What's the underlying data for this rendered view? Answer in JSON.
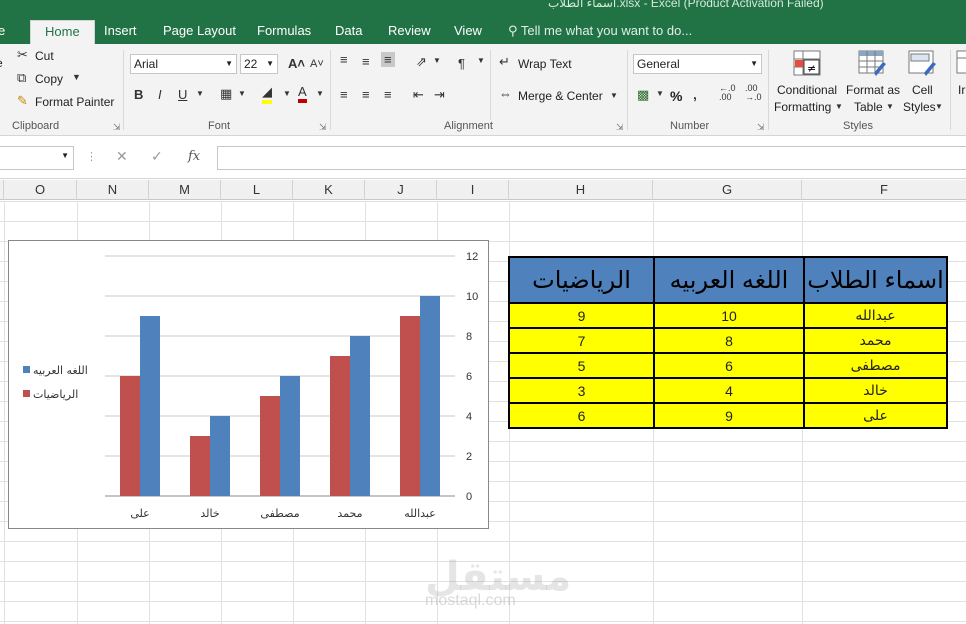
{
  "window": {
    "title": "اسماء الطلاب.xlsx - Excel (Product Activation Failed)"
  },
  "tabs": [
    "Home",
    "Insert",
    "Page Layout",
    "Formulas",
    "Data",
    "Review",
    "View"
  ],
  "tell_me": "Tell me what you want to do...",
  "ribbon": {
    "clipboard": {
      "label": "Clipboard",
      "cut": "Cut",
      "copy": "Copy",
      "format_painter": "Format Painter"
    },
    "font": {
      "label": "Font",
      "name": "Arial",
      "size": "22"
    },
    "alignment": {
      "label": "Alignment",
      "wrap_text": "Wrap Text",
      "merge_center": "Merge & Center"
    },
    "number": {
      "label": "Number",
      "format": "General",
      "percent": "%"
    },
    "styles": {
      "label": "Styles",
      "conditional_1": "Conditional",
      "conditional_2": "Formatting",
      "format_as_1": "Format as",
      "format_as_2": "Table",
      "cell_1": "Cell",
      "cell_2": "Styles",
      "insert_partial": "Ir"
    }
  },
  "formula_bar": {
    "fx": "fx",
    "value": ""
  },
  "columns": [
    "O",
    "N",
    "M",
    "L",
    "K",
    "J",
    "I",
    "H",
    "G",
    "F"
  ],
  "table": {
    "headers": [
      "الرياضيات",
      "اللغه العربيه",
      "اسماء الطلاب"
    ],
    "rows": [
      [
        "9",
        "10",
        "عبدالله"
      ],
      [
        "7",
        "8",
        "محمد"
      ],
      [
        "5",
        "6",
        "مصطفى"
      ],
      [
        "3",
        "4",
        "خالد"
      ],
      [
        "6",
        "9",
        "على"
      ]
    ]
  },
  "chart_data": {
    "type": "bar",
    "categories": [
      "على",
      "خالد",
      "مصطفى",
      "محمد",
      "عبدالله"
    ],
    "series": [
      {
        "name": "الرياضيات",
        "color": "#c0504d",
        "values": [
          6,
          3,
          5,
          7,
          9
        ]
      },
      {
        "name": "اللغه العربيه",
        "color": "#4f81bd",
        "values": [
          9,
          4,
          6,
          8,
          10
        ]
      }
    ],
    "ylim": [
      0,
      12
    ],
    "yticks": [
      "0",
      "2",
      "4",
      "6",
      "8",
      "10",
      "12"
    ],
    "y_axis_side": "right",
    "grid": true,
    "legend_position": "left",
    "legend": [
      "اللغه العربيه",
      "الرياضيات"
    ]
  },
  "watermark": {
    "logo": "مستقل",
    "site": "mostaql.com"
  }
}
